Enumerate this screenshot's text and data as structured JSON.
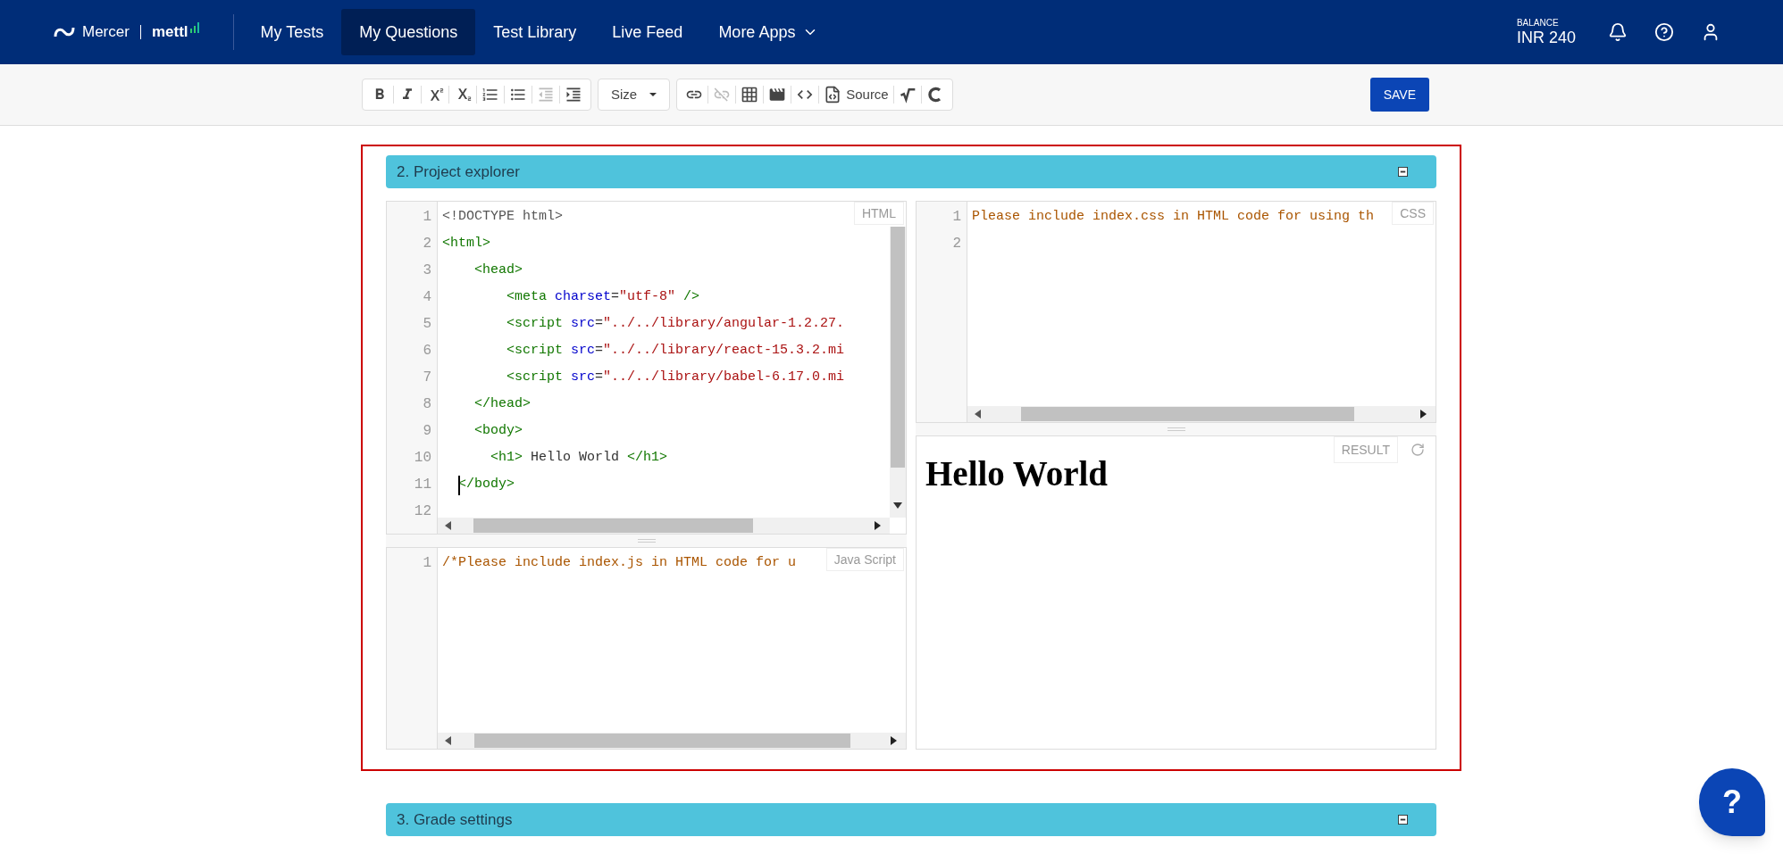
{
  "header": {
    "logo": {
      "brand": "Mercer",
      "product": "mettl"
    },
    "nav": [
      {
        "label": "My Tests",
        "selected": false,
        "has_menu": false
      },
      {
        "label": "My Questions",
        "selected": true,
        "has_menu": false
      },
      {
        "label": "Test Library",
        "selected": false,
        "has_menu": false
      },
      {
        "label": "Live Feed",
        "selected": false,
        "has_menu": false
      },
      {
        "label": "More Apps",
        "selected": false,
        "has_menu": true
      }
    ],
    "balance": {
      "label": "BALANCE",
      "value": "INR 240"
    }
  },
  "toolbar": {
    "groups": [
      {
        "items": [
          {
            "kind": "icon",
            "disabled": false
          },
          {
            "kind": "icon",
            "disabled": false
          },
          {
            "kind": "icon",
            "disabled": false
          },
          {
            "kind": "icon",
            "disabled": false
          },
          {
            "kind": "icon",
            "disabled": false
          },
          {
            "kind": "icon",
            "disabled": false
          },
          {
            "kind": "icon",
            "disabled": true
          },
          {
            "kind": "icon",
            "disabled": false
          }
        ]
      },
      {
        "items": [
          {
            "kind": "dropdown",
            "label": "Size",
            "disabled": false
          }
        ]
      },
      {
        "items": [
          {
            "kind": "icon",
            "disabled": false
          },
          {
            "kind": "icon",
            "disabled": true
          },
          {
            "kind": "icon",
            "disabled": false
          },
          {
            "kind": "icon",
            "disabled": false
          },
          {
            "kind": "icon",
            "disabled": false
          },
          {
            "kind": "labeled",
            "label": "Source",
            "disabled": false
          },
          {
            "kind": "icon",
            "disabled": false
          },
          {
            "kind": "icon",
            "disabled": false
          }
        ]
      }
    ],
    "save": "SAVE"
  },
  "sections": [
    {
      "title": "2. Project explorer",
      "selected": true,
      "editors": {
        "html": {
          "label": "HTML",
          "lines": [
            {
              "number": "1",
              "tokens": [
                {
                  "kind": "meta",
                  "text": "<!DOCTYPE html>"
                }
              ]
            },
            {
              "number": "2",
              "tokens": [
                {
                  "kind": "tag",
                  "text": "<html>"
                }
              ]
            },
            {
              "number": "3",
              "tokens": [
                {
                  "kind": "tag",
                  "text": "    <head>"
                }
              ]
            },
            {
              "number": "4",
              "tokens": [
                {
                  "kind": "tag",
                  "text": "        <meta"
                },
                {
                  "kind": "attr",
                  "text": " charset"
                },
                {
                  "kind": "plain",
                  "text": "="
                },
                {
                  "kind": "string",
                  "text": "\"utf-8\""
                },
                {
                  "kind": "tag",
                  "text": " />"
                }
              ]
            },
            {
              "number": "5",
              "tokens": [
                {
                  "kind": "tag",
                  "text": "        <script"
                },
                {
                  "kind": "attr",
                  "text": " src"
                },
                {
                  "kind": "plain",
                  "text": "="
                },
                {
                  "kind": "string",
                  "text": "\"../../library/angular-1.2.27."
                }
              ]
            },
            {
              "number": "6",
              "tokens": [
                {
                  "kind": "tag",
                  "text": "        <script"
                },
                {
                  "kind": "attr",
                  "text": " src"
                },
                {
                  "kind": "plain",
                  "text": "="
                },
                {
                  "kind": "string",
                  "text": "\"../../library/react-15.3.2.mi"
                }
              ]
            },
            {
              "number": "7",
              "tokens": [
                {
                  "kind": "tag",
                  "text": "        <script"
                },
                {
                  "kind": "attr",
                  "text": " src"
                },
                {
                  "kind": "plain",
                  "text": "="
                },
                {
                  "kind": "string",
                  "text": "\"../../library/babel-6.17.0.mi"
                }
              ]
            },
            {
              "number": "8",
              "tokens": [
                {
                  "kind": "tag",
                  "text": "    </head>"
                }
              ]
            },
            {
              "number": "9",
              "tokens": [
                {
                  "kind": "tag",
                  "text": "    <body>"
                }
              ]
            },
            {
              "number": "10",
              "tokens": [
                {
                  "kind": "tag",
                  "text": "      <h1>"
                },
                {
                  "kind": "plain",
                  "text": " Hello World "
                },
                {
                  "kind": "tag",
                  "text": "</h1>"
                }
              ]
            },
            {
              "number": "11",
              "cursor": true,
              "tokens": [
                {
                  "kind": "tag",
                  "text": "  </body>"
                }
              ]
            },
            {
              "number": "12"
            }
          ]
        },
        "css": {
          "label": "CSS",
          "lines": [
            {
              "number": "1",
              "tokens": [
                {
                  "kind": "comment",
                  "text": "Please include index.css in HTML code for using th"
                }
              ]
            },
            {
              "number": "2"
            }
          ]
        },
        "js": {
          "label": "Java Script",
          "lines": [
            {
              "number": "1",
              "tokens": [
                {
                  "kind": "comment",
                  "text": "/*Please include index.js in HTML code for u"
                }
              ]
            }
          ]
        },
        "result": {
          "label": "RESULT",
          "heading": "Hello World"
        }
      }
    },
    {
      "title": "3. Grade settings",
      "selected": false
    }
  ],
  "help_button": {
    "label": "?"
  }
}
